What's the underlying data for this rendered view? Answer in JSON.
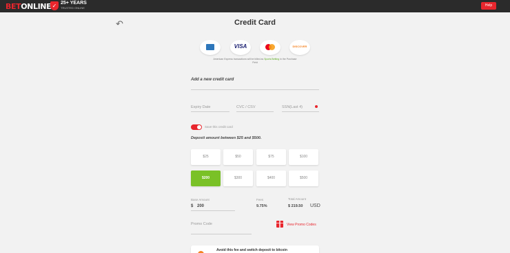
{
  "header": {
    "logo_bet": "BET",
    "logo_online": "ONLINE",
    "badge_title": "25+ YEARS",
    "badge_subtitle": "TRUSTED ONLINE",
    "badge_icon": "shield-check-icon",
    "help_label": "Help"
  },
  "page": {
    "title": "Credit Card",
    "back_icon": "undo-arrow-icon"
  },
  "card_logos": [
    {
      "name": "amex"
    },
    {
      "name": "visa",
      "label": "VISA"
    },
    {
      "name": "mastercard"
    },
    {
      "name": "discover",
      "label": "DISCOVER"
    }
  ],
  "accept_note": {
    "line1": "American Express transactions will be billed as",
    "highlight": "Sports Betting",
    "line2": "in the Purchase",
    "line3": "Field"
  },
  "form": {
    "new_card_label": "Add a new credit card",
    "expiry_placeholder": "Expiry Date",
    "cvc_placeholder": "CVC / CSV",
    "ssn_placeholder": "SSN(Last 4)",
    "save_card_label": "Save this credit card"
  },
  "deposit": {
    "heading": "Deposit amount between $25 and $500.",
    "amounts": [
      "$25",
      "$50",
      "$75",
      "$100",
      "$200",
      "$300",
      "$400",
      "$500"
    ],
    "selected": "$200"
  },
  "summary": {
    "base_label": "Base Amount",
    "currency_symbol": "$",
    "base_value": "200",
    "fees_label": "Fees",
    "fees_value": "9.75%",
    "total_label": "Total Amount",
    "total_value": "$ 219.50",
    "total_currency": "USD"
  },
  "promo": {
    "label": "Promo Code",
    "view_link": "View Promo Codes",
    "icon": "gift-icon"
  },
  "bottom_card": {
    "text": "Avoid this fee and switch deposit to bitcoin"
  },
  "colors": {
    "brand_red": "#e8262d",
    "selected_green": "#7ac127",
    "topbar": "#2b2b2b",
    "background": "#f2f2f2"
  }
}
